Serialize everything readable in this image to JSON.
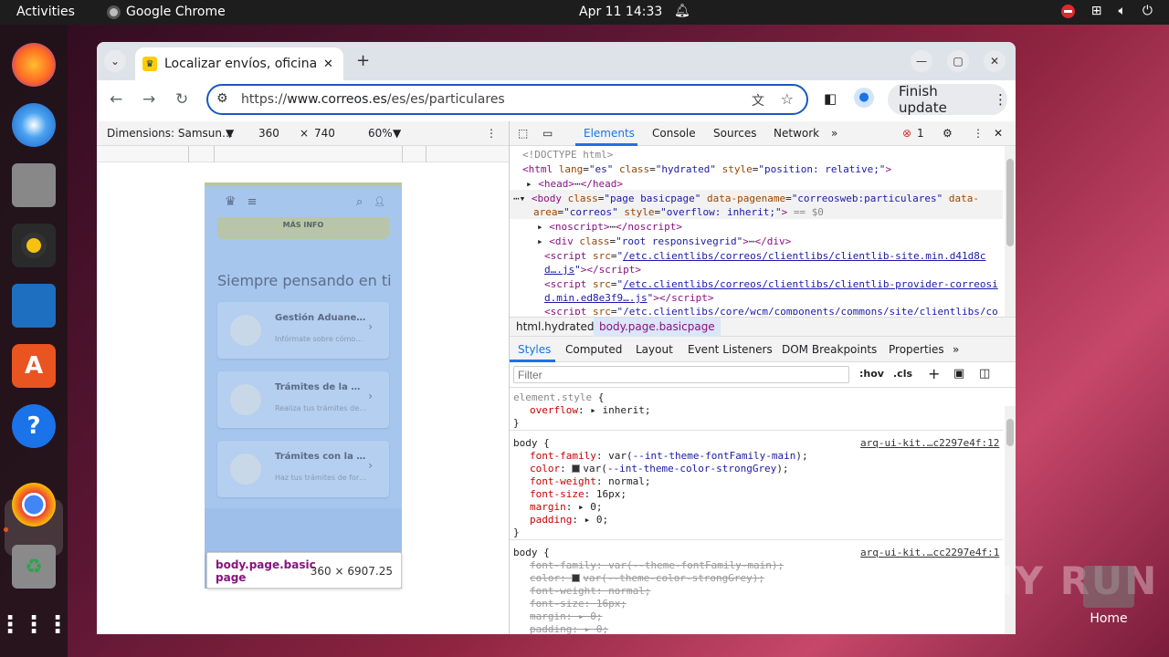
{
  "topbar": {
    "activities": "Activities",
    "app_name": "Google Chrome",
    "datetime": "Apr 11  14:33"
  },
  "browser": {
    "tab_title": "Localizar envíos, oficinas",
    "url_prefix": "https://",
    "url_domain": "www.correos.es",
    "url_path": "/es/es/particulares",
    "finish_update": "Finish update"
  },
  "device_toolbar": {
    "dimensions_label": "Dimensions: Samsun…",
    "width": "360",
    "times": "×",
    "height": "740",
    "zoom": "60%"
  },
  "page": {
    "banner_text": "MÁS INFO",
    "heading": "Siempre pensando en ti",
    "cards": [
      {
        "title": "Gestión Aduane…",
        "desc": "Infórmate sobre cómo…"
      },
      {
        "title": "Trámites de la …",
        "desc": "Realiza tus trámites de…"
      },
      {
        "title": "Trámites con la …",
        "desc": "Haz tus trámites de for…"
      }
    ],
    "tooltip_selector": "body.page.basic page",
    "tooltip_dims": "360 × 6907.25"
  },
  "devtools": {
    "tabs": [
      "Elements",
      "Console",
      "Sources",
      "Network"
    ],
    "error_count": "1",
    "dom_lines": [
      "<!DOCTYPE html>",
      "$0"
    ],
    "breadcrumbs": [
      "html.hydrated",
      "body.page.basicpage"
    ],
    "style_tabs": [
      "Styles",
      "Computed",
      "Layout",
      "Event Listeners",
      "DOM Breakpoints",
      "Properties"
    ],
    "filter_placeholder": "Filter",
    "hov": ":hov",
    "cls": ".cls",
    "rules": {
      "element_style": "element.style",
      "r1_selector": "body",
      "r1_src": "arq-ui-kit.…c2297e4f:12",
      "r2_selector": "body",
      "r2_src": "arq-ui-kit.…cc2297e4f:1"
    }
  },
  "watermark": {
    "text": "ANY RUN",
    "home_label": "Home"
  }
}
